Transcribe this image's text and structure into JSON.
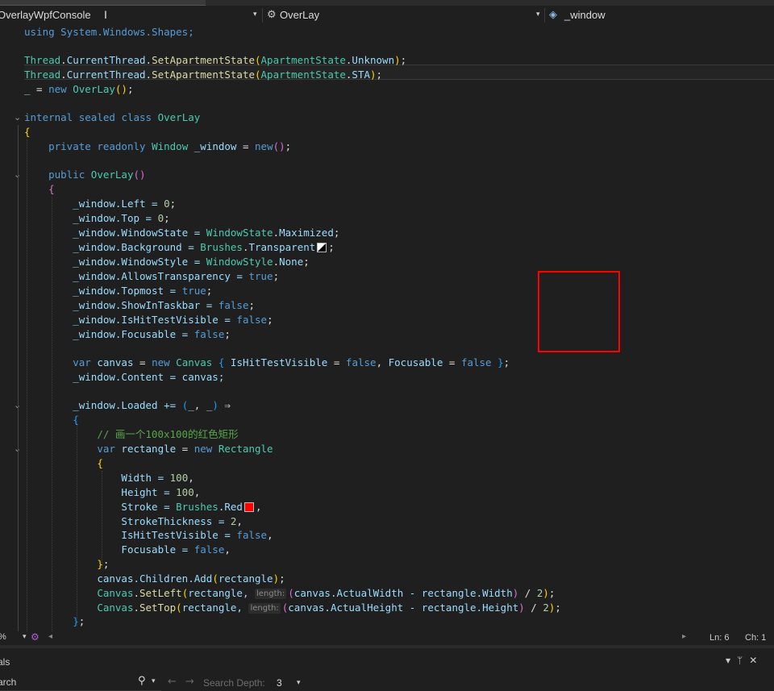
{
  "navbar": {
    "project": "OverlayWpfConsole",
    "class_name": "OverLay",
    "member": "_window"
  },
  "code": {
    "l1": [
      "using System.Windows.Shapes;"
    ],
    "l3a": "Thread",
    "l3b": "CurrentThread",
    "l3c": "SetApartmentState",
    "l3d": "ApartmentState",
    "l3e": "Unknown",
    "l4e": "STA",
    "l5a": "_",
    "l5b": "new",
    "l5c": "OverLay",
    "l7a": "internal",
    "l7b": "sealed",
    "l7c": "class",
    "l7d": "OverLay",
    "l9a": "private",
    "l9b": "readonly",
    "l9c": "Window",
    "l9d": "_window",
    "l9e": "new",
    "l11a": "public",
    "l11b": "OverLay",
    "w_left": "_window.Left = ",
    "w_left_v": "0",
    "w_top": "_window.Top = ",
    "w_top_v": "0",
    "w_state": "_window.WindowState = ",
    "w_state_c": "WindowState",
    "w_state_v": "Maximized",
    "w_bg": "_window.Background = ",
    "w_bg_c": "Brushes",
    "w_bg_v": "Transparent",
    "w_style": "_window.WindowStyle = ",
    "w_style_c": "WindowStyle",
    "w_style_v": "None",
    "w_allow": "_window.AllowsTransparency = ",
    "w_allow_v": "true",
    "w_topmost": "_window.Topmost = ",
    "w_topmost_v": "true",
    "w_taskbar": "_window.ShowInTaskbar = ",
    "w_taskbar_v": "false",
    "w_hit": "_window.IsHitTestVisible = ",
    "w_hit_v": "false",
    "w_focus": "_window.Focusable = ",
    "w_focus_v": "false",
    "c_var": "var",
    "c_name": "canvas",
    "c_new": "new",
    "c_cls": "Canvas",
    "c_p1": "IsHitTestVisible",
    "c_p2": "Focusable",
    "c_false": "false",
    "content": "_window.Content = canvas;",
    "loaded": "_window.Loaded += ",
    "comment": "// 画一个100x100的红色矩形",
    "r_var": "var",
    "r_name": "rectangle",
    "r_new": "new",
    "r_cls": "Rectangle",
    "r_w": "Width = ",
    "r_w_v": "100",
    "r_h": "Height = ",
    "r_h_v": "100",
    "r_s": "Stroke = ",
    "r_s_c": "Brushes",
    "r_s_v": "Red",
    "r_st": "StrokeThickness = ",
    "r_st_v": "2",
    "r_hit": "IsHitTestVisible = ",
    "r_hit_v": "false",
    "r_foc": "Focusable = ",
    "r_foc_v": "false",
    "add": "canvas.Children.Add",
    "add_arg": "rectangle",
    "setleft_c": "Canvas",
    "setleft_m": "SetLeft",
    "setleft_a": "rectangle, ",
    "hint": "length:",
    "setleft_e": "canvas.ActualWidth - rectangle.Width",
    "settop_m": "SetTop",
    "settop_e": "canvas.ActualHeight - rectangle.Height",
    "two": "2"
  },
  "status": {
    "zoom": "%",
    "line": "Ln: 6",
    "col": "Ch: 1"
  },
  "panel": {
    "title": "als",
    "search_placeholder": "arch",
    "depth_label": "Search Depth:",
    "depth_value": "3"
  },
  "colors": {
    "background": "#1f1f1f",
    "keyword": "#569cd6",
    "type": "#4ec9b0",
    "method": "#dcdcaa",
    "number": "#b5cea8",
    "comment": "#57a64a",
    "overlay_rect": "#ff0000"
  }
}
